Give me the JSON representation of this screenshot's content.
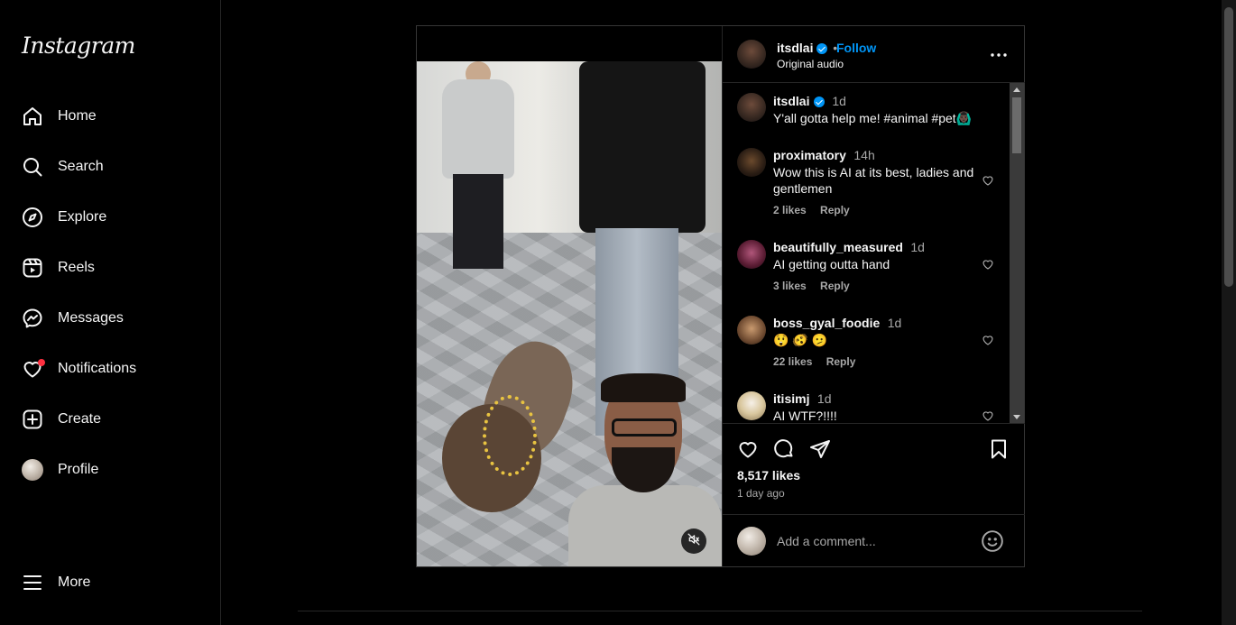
{
  "sidebar": {
    "logo": "Instagram",
    "items": [
      {
        "label": "Home",
        "icon": "home-icon"
      },
      {
        "label": "Search",
        "icon": "search-icon"
      },
      {
        "label": "Explore",
        "icon": "compass-icon"
      },
      {
        "label": "Reels",
        "icon": "reels-icon"
      },
      {
        "label": "Messages",
        "icon": "messenger-icon"
      },
      {
        "label": "Notifications",
        "icon": "heart-icon"
      },
      {
        "label": "Create",
        "icon": "plus-square-icon"
      },
      {
        "label": "Profile",
        "icon": "avatar"
      }
    ],
    "more_label": "More"
  },
  "post": {
    "author": "itsdlai",
    "verified": true,
    "separator": "•",
    "follow_label": "Follow",
    "audio": "Original audio",
    "caption": {
      "username": "itsdlai",
      "time": "1d",
      "text": "Y'all gotta help me! #animal #pet🙆🏿‍♂️"
    },
    "comments": [
      {
        "username": "proximatory",
        "time": "14h",
        "text": "Wow this is AI at its best, ladies and gentlemen",
        "likes": "2 likes",
        "reply": "Reply"
      },
      {
        "username": "beautifully_measured",
        "time": "1d",
        "text": "AI getting outta hand",
        "likes": "3 likes",
        "reply": "Reply"
      },
      {
        "username": "boss_gyal_foodie",
        "time": "1d",
        "text": "😲 🫨 🫤",
        "likes": "22 likes",
        "reply": "Reply"
      },
      {
        "username": "itisimj",
        "time": "1d",
        "text": "AI WTF?!!!!",
        "likes": "",
        "reply": ""
      }
    ],
    "likes_count": "8,517 likes",
    "posted": "1 day ago",
    "comment_placeholder": "Add a comment..."
  },
  "colors": {
    "accent": "#0095f6",
    "notification_dot": "#ff3040",
    "background": "#000000",
    "muted": "#a8a8a8"
  }
}
